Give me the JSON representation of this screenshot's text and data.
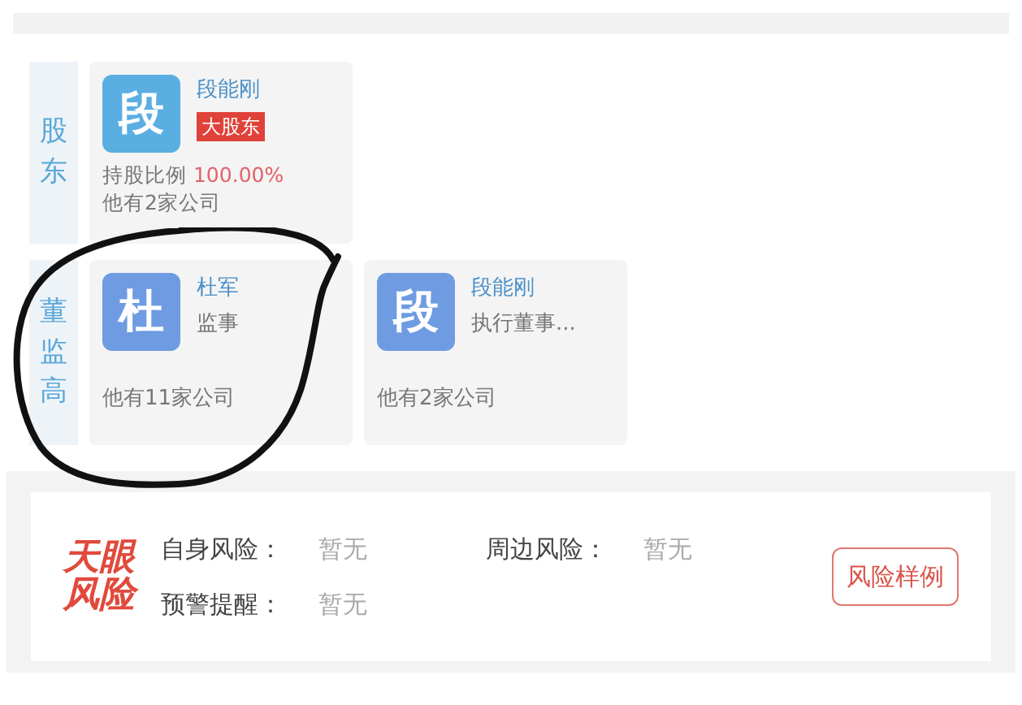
{
  "shareholders": {
    "label": "股东",
    "items": [
      {
        "avatar": "段",
        "color": "#5aaee2",
        "name": "段能刚",
        "badge": "大股东",
        "share_label": "持股比例",
        "share_value": "100.00%",
        "companies": "他有2家公司"
      }
    ]
  },
  "executives": {
    "label": "董监高",
    "items": [
      {
        "avatar": "杜",
        "color": "#6e9be2",
        "name": "杜军",
        "role": "监事",
        "companies": "他有11家公司"
      },
      {
        "avatar": "段",
        "color": "#6e9be2",
        "name": "段能刚",
        "role": "执行董事...",
        "companies": "他有2家公司"
      }
    ]
  },
  "risk": {
    "logo": "天眼风险",
    "rows": [
      {
        "label": "自身风险：",
        "value": "暂无"
      },
      {
        "label": "周边风险：",
        "value": "暂无"
      },
      {
        "label": "预警提醒：",
        "value": "暂无"
      }
    ],
    "button": "风险样例"
  }
}
